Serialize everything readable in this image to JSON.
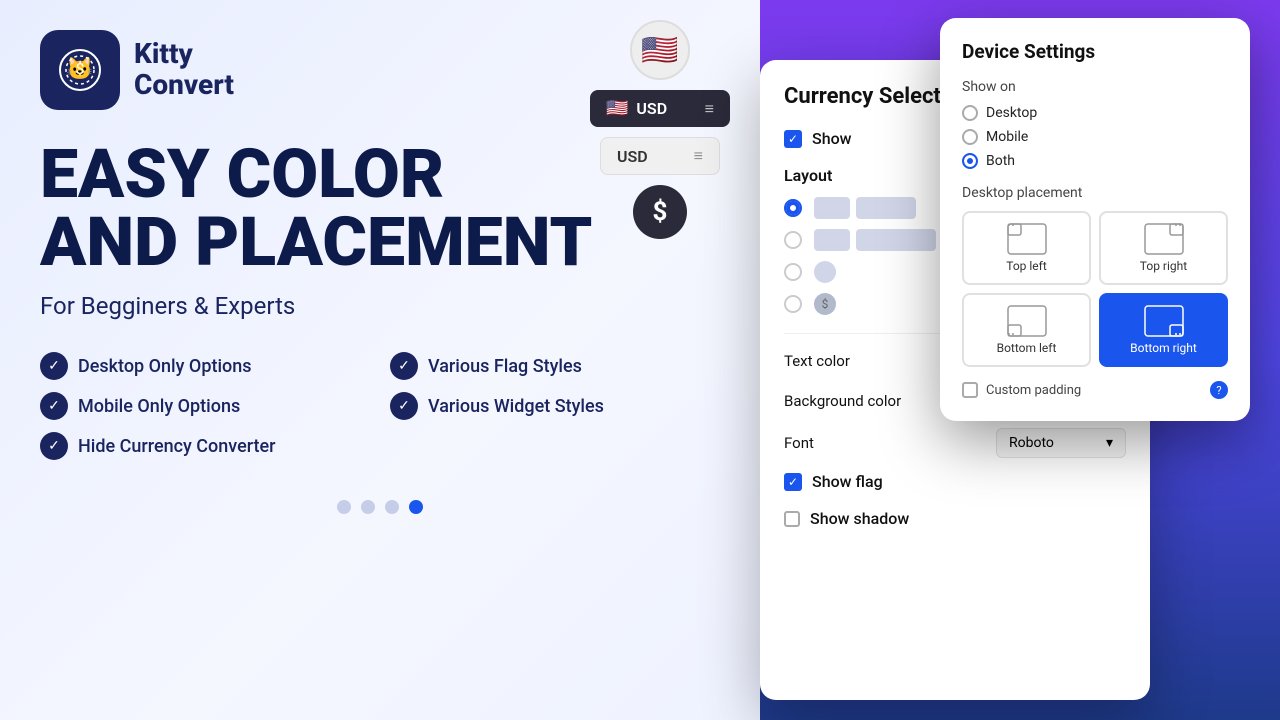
{
  "logo": {
    "icon": "🐱",
    "name_line1": "Kitty",
    "name_line2": "Convert"
  },
  "hero": {
    "heading_line1": "EASY COLOR",
    "heading_line2": "AND PLACEMENT",
    "subheading": "For Begginers & Experts"
  },
  "features": [
    {
      "text": "Desktop Only Options"
    },
    {
      "text": "Various Flag Styles"
    },
    {
      "text": "Mobile Only Options"
    },
    {
      "text": "Various Widget Styles"
    },
    {
      "text": "Hide Currency Converter"
    }
  ],
  "dots": [
    {
      "active": false
    },
    {
      "active": false
    },
    {
      "active": false
    },
    {
      "active": true
    }
  ],
  "widget_previews": {
    "flag_emoji": "🇺🇸",
    "currency_code": "USD",
    "currency_code2": "USD",
    "dollar_symbol": "$"
  },
  "currency_selector": {
    "title": "Currency Selector",
    "show_label": "Show",
    "show_checked": true,
    "layout_label": "Layout",
    "text_color_label": "Text color",
    "bg_color_label": "Background color",
    "font_label": "Font",
    "font_value": "Roboto",
    "show_flag_label": "Show flag",
    "show_flag_checked": true,
    "show_shadow_label": "Show shadow",
    "show_shadow_checked": false
  },
  "device_settings": {
    "title": "Device Settings",
    "show_on_label": "Show on",
    "options": [
      {
        "label": "Desktop",
        "selected": false
      },
      {
        "label": "Mobile",
        "selected": false
      },
      {
        "label": "Both",
        "selected": true
      }
    ],
    "placement_label": "Desktop placement",
    "placements": [
      {
        "label": "Top left",
        "position": "top-left",
        "active": false
      },
      {
        "label": "Top right",
        "position": "top-right",
        "active": false
      },
      {
        "label": "Bottom left",
        "position": "bottom-left",
        "active": false
      },
      {
        "label": "Bottom right",
        "position": "bottom-right",
        "active": true
      }
    ],
    "custom_padding_label": "Custom padding"
  }
}
